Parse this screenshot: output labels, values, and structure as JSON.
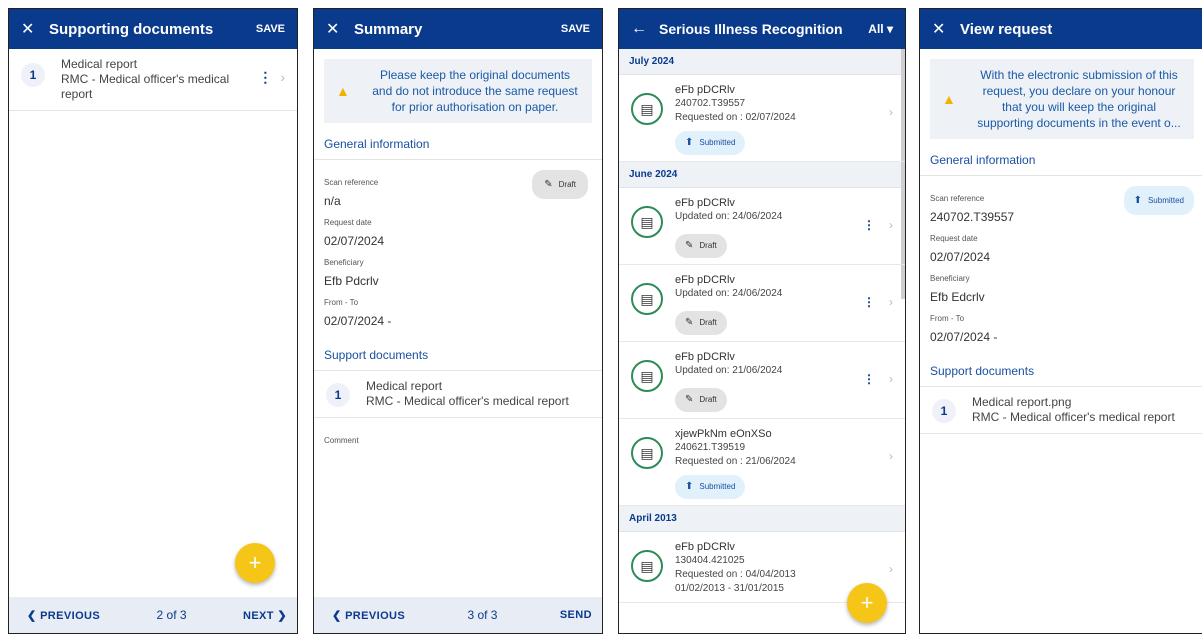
{
  "panel1": {
    "title": "Supporting documents",
    "save": "SAVE",
    "close_icon": "close-icon",
    "documents": [
      {
        "num": "1",
        "title": "Medical report",
        "desc": "RMC - Medical officer's medical report"
      }
    ],
    "footer": {
      "prev": "❮ PREVIOUS",
      "page": "2 of 3",
      "next": "NEXT ❯"
    },
    "fab": "+"
  },
  "panel2": {
    "title": "Summary",
    "save": "SAVE",
    "warning": "Please keep the original documents and do not introduce the same request for prior authorisation on paper.",
    "general_info": "General information",
    "fields": {
      "scan_ref_label": "Scan reference",
      "scan_ref_value": "n/a",
      "status": "Draft",
      "request_date_label": "Request date",
      "request_date_value": "02/07/2024",
      "beneficiary_label": "Beneficiary",
      "beneficiary_value": "Efb Pdcrlv",
      "from_to_label": "From - To",
      "from_to_value": "02/07/2024 -"
    },
    "support_docs": "Support documents",
    "document": {
      "num": "1",
      "title": "Medical report",
      "desc": "RMC - Medical officer's medical report"
    },
    "comment_label": "Comment",
    "footer": {
      "prev": "❮ PREVIOUS",
      "page": "3 of 3",
      "send": "SEND"
    }
  },
  "panel3": {
    "title": "Serious Illness Recognition",
    "filter": "All ▾",
    "groups": [
      {
        "label": "July 2024",
        "items": [
          {
            "name": "eFb pDCRlv",
            "line2": "240702.T39557",
            "line3": "Requested on : 02/07/2024",
            "line4": "",
            "status": "Submitted",
            "kebab": false
          }
        ]
      },
      {
        "label": "June 2024",
        "items": [
          {
            "name": "eFb pDCRlv",
            "line2": "Updated on: 24/06/2024",
            "line3": "",
            "line4": "",
            "status": "Draft",
            "kebab": true
          },
          {
            "name": "eFb pDCRlv",
            "line2": "Updated on: 24/06/2024",
            "line3": "",
            "line4": "",
            "status": "Draft",
            "kebab": true
          },
          {
            "name": "eFb pDCRlv",
            "line2": "Updated on: 21/06/2024",
            "line3": "",
            "line4": "",
            "status": "Draft",
            "kebab": true
          },
          {
            "name": "xjewPkNm eOnXSo",
            "line2": "240621.T39519",
            "line3": "Requested on : 21/06/2024",
            "line4": "",
            "status": "Submitted",
            "kebab": false
          }
        ]
      },
      {
        "label": "April 2013",
        "items": [
          {
            "name": "eFb pDCRlv",
            "line2": "130404.421025",
            "line3": "Requested on : 04/04/2013",
            "line4": "01/02/2013 - 31/01/2015",
            "status": "",
            "kebab": false
          }
        ]
      }
    ],
    "fab": "+"
  },
  "panel4": {
    "title": "View request",
    "warning": "With the electronic submission of this request, you declare on your honour that you will keep the original supporting documents in the event o...",
    "general_info": "General information",
    "fields": {
      "scan_ref_label": "Scan reference",
      "scan_ref_value": "240702.T39557",
      "status": "Submitted",
      "request_date_label": "Request date",
      "request_date_value": "02/07/2024",
      "beneficiary_label": "Beneficiary",
      "beneficiary_value": "Efb Edcrlv",
      "from_to_label": "From - To",
      "from_to_value": "02/07/2024 -"
    },
    "support_docs": "Support documents",
    "document": {
      "num": "1",
      "title": "Medical report.png",
      "desc": "RMC - Medical officer's medical report"
    }
  },
  "colors": {
    "header": "#0a3a8c",
    "fab": "#f5c518",
    "warning_icon": "#f0b400",
    "submitted_bg": "#e1f1fb"
  }
}
